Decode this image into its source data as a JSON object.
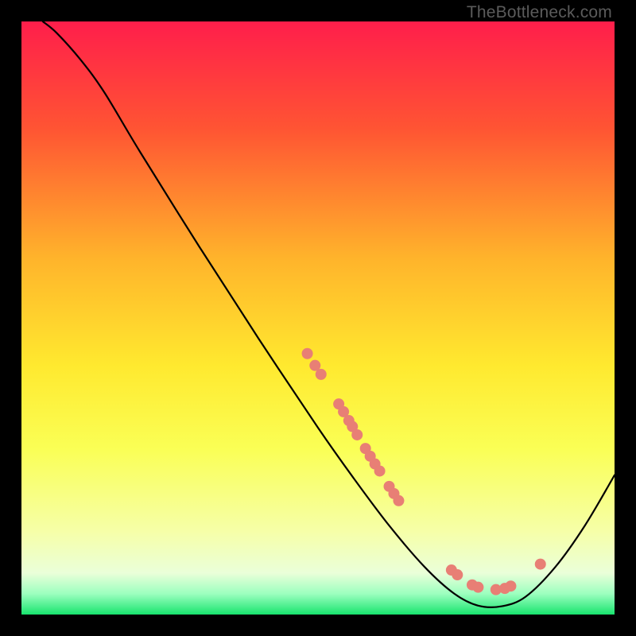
{
  "watermark": "TheBottleneck.com",
  "chart_data": {
    "type": "line",
    "title": "",
    "xlabel": "",
    "ylabel": "",
    "xlim": [
      0,
      100
    ],
    "ylim": [
      0,
      100
    ],
    "gradient_stops": [
      {
        "offset": 0,
        "color": "#ff1e4b"
      },
      {
        "offset": 18,
        "color": "#ff5433"
      },
      {
        "offset": 40,
        "color": "#ffb42b"
      },
      {
        "offset": 58,
        "color": "#ffe92f"
      },
      {
        "offset": 72,
        "color": "#faff55"
      },
      {
        "offset": 86,
        "color": "#f6ffa8"
      },
      {
        "offset": 93,
        "color": "#eaffd9"
      },
      {
        "offset": 96.5,
        "color": "#9cffbf"
      },
      {
        "offset": 100,
        "color": "#18e46e"
      }
    ],
    "curve": [
      {
        "x": 3.6,
        "y": 100.0
      },
      {
        "x": 6.0,
        "y": 98.0
      },
      {
        "x": 10.0,
        "y": 93.5
      },
      {
        "x": 14.0,
        "y": 88.0
      },
      {
        "x": 20.0,
        "y": 78.0
      },
      {
        "x": 30.0,
        "y": 62.0
      },
      {
        "x": 40.0,
        "y": 46.5
      },
      {
        "x": 50.0,
        "y": 31.5
      },
      {
        "x": 56.0,
        "y": 23.0
      },
      {
        "x": 62.0,
        "y": 15.0
      },
      {
        "x": 68.0,
        "y": 8.0
      },
      {
        "x": 73.0,
        "y": 3.5
      },
      {
        "x": 77.0,
        "y": 1.5
      },
      {
        "x": 81.0,
        "y": 1.4
      },
      {
        "x": 85.0,
        "y": 3.0
      },
      {
        "x": 90.0,
        "y": 8.0
      },
      {
        "x": 95.0,
        "y": 15.0
      },
      {
        "x": 100.0,
        "y": 23.5
      }
    ],
    "markers": [
      {
        "x": 48.2,
        "y": 44.0
      },
      {
        "x": 49.5,
        "y": 42.0
      },
      {
        "x": 50.5,
        "y": 40.5
      },
      {
        "x": 53.5,
        "y": 35.5
      },
      {
        "x": 54.3,
        "y": 34.2
      },
      {
        "x": 55.2,
        "y": 32.7
      },
      {
        "x": 55.8,
        "y": 31.7
      },
      {
        "x": 56.6,
        "y": 30.3
      },
      {
        "x": 58.0,
        "y": 28.0
      },
      {
        "x": 58.8,
        "y": 26.7
      },
      {
        "x": 59.6,
        "y": 25.4
      },
      {
        "x": 60.4,
        "y": 24.2
      },
      {
        "x": 62.0,
        "y": 21.6
      },
      {
        "x": 62.8,
        "y": 20.4
      },
      {
        "x": 63.6,
        "y": 19.2
      },
      {
        "x": 72.5,
        "y": 7.5
      },
      {
        "x": 73.5,
        "y": 6.7
      },
      {
        "x": 76.0,
        "y": 5.0
      },
      {
        "x": 77.0,
        "y": 4.6
      },
      {
        "x": 80.0,
        "y": 4.2
      },
      {
        "x": 81.5,
        "y": 4.4
      },
      {
        "x": 82.5,
        "y": 4.8
      },
      {
        "x": 87.5,
        "y": 8.5
      }
    ],
    "marker_color": "#e87f75",
    "marker_radius_px": 7
  }
}
